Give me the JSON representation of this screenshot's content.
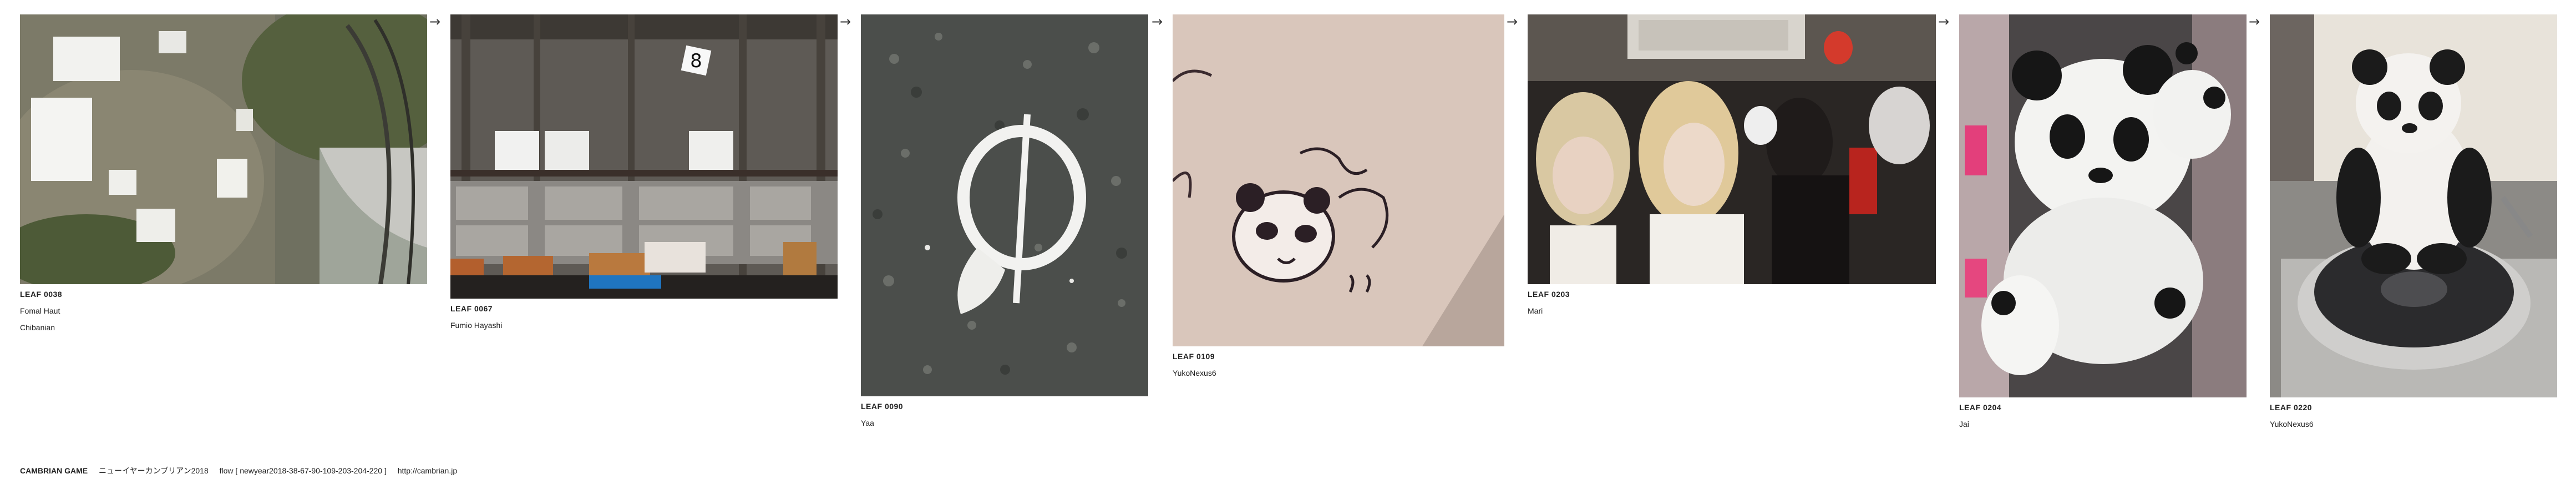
{
  "flow_arrow": "→",
  "leaves": [
    {
      "id": "LEAF 0038",
      "author": "Fomal Haut",
      "tag": "Chibanian",
      "image": "rock-wall-with-notices"
    },
    {
      "id": "LEAF 0067",
      "author": "Fumio Hayashi",
      "image": "warehouse-crates-sign-8"
    },
    {
      "id": "LEAF 0090",
      "author": "Yaa",
      "image": "asphalt-white-mark"
    },
    {
      "id": "LEAF 0109",
      "author": "YukoNexus6",
      "image": "panda-doodle-note"
    },
    {
      "id": "LEAF 0203",
      "author": "Mari",
      "image": "street-crowd-costumes"
    },
    {
      "id": "LEAF 0204",
      "author": "Jai",
      "image": "panda-plush-hats"
    },
    {
      "id": "LEAF 0220",
      "author": "YukoNexus6",
      "image": "panda-plush-on-turntable"
    }
  ],
  "footer": {
    "brand": "CAMBRIAN GAME",
    "title": "ニューイヤーカンブリアン2018",
    "flow": "flow [ newyear2018-38-67-90-109-203-204-220 ]",
    "url": "http://cambrian.jp"
  }
}
